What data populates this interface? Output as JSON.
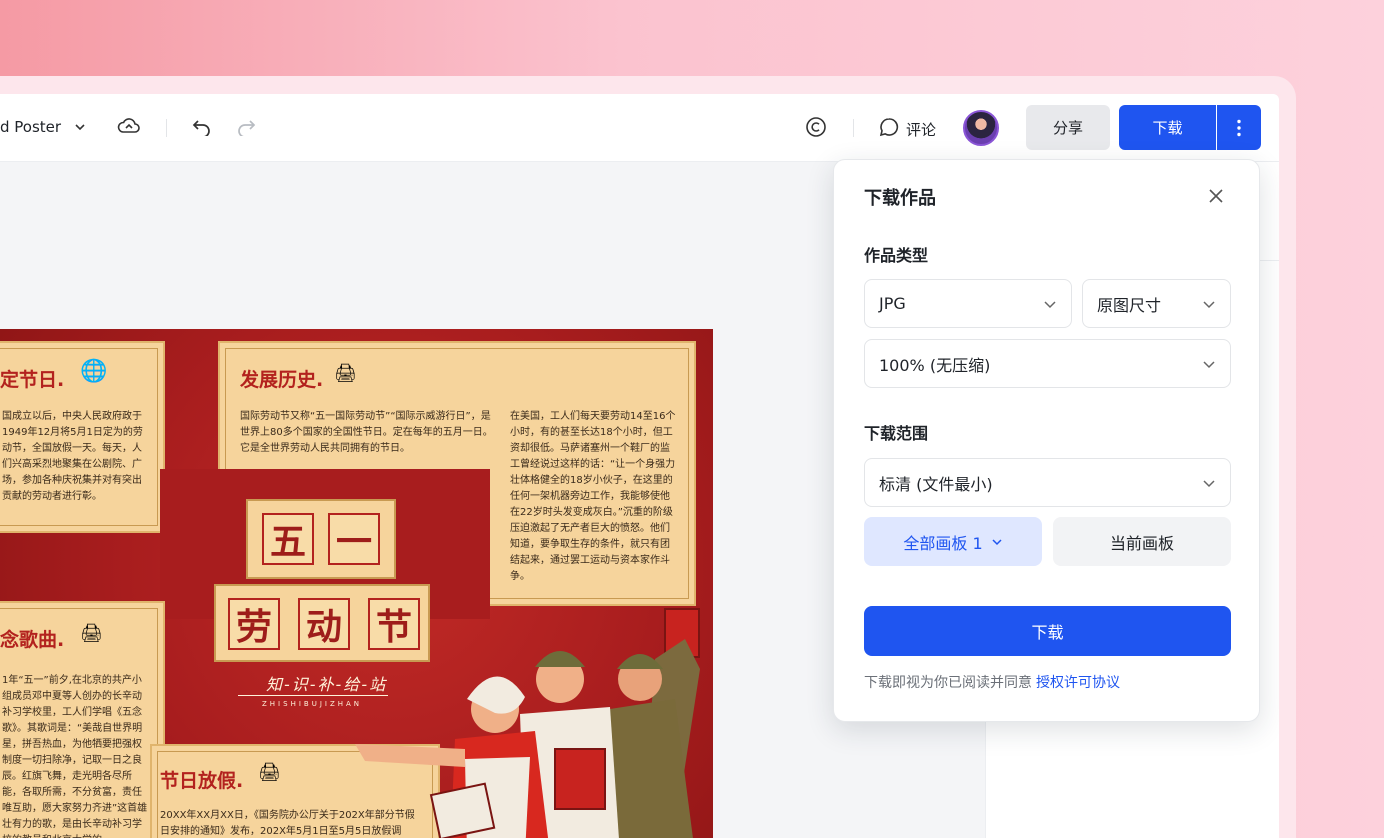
{
  "toolbar": {
    "doc_title": "d Poster",
    "comment_label": "评论",
    "share_label": "分享",
    "download_label": "下载"
  },
  "poster": {
    "card1": {
      "title": "定节日.",
      "text": "国成立以后，中央人民政府政于1949年12月将5月1日定为的劳动节，全国放假一天。每天，人们兴高采烈地聚集在公剧院、广场，参加各种庆祝集并对有突出贡献的劳动者进行彰。"
    },
    "card2": {
      "title": "发展历史.",
      "text_left": "国际劳动节又称“五一国际劳动节”“国际示威游行日”，是世界上80多个国家的全国性节日。定在每年的五月一日。它是全世界劳动人民共同拥有的节日。",
      "text_right": "在美国，工人们每天要劳动14至16个小时，有的甚至长达18个小时，但工资却很低。马萨诸塞州一个鞋厂的监工曾经说过这样的话：“让一个身强力壮体格健全的18岁小伙子，在这里的任何一架机器旁边工作，我能够使他在22岁时头发变成灰白。”沉重的阶级压迫激起了无产者巨大的愤怒。他们知道，要争取生存的条件，就只有团结起来，通过罢工运动与资本家作斗争。"
    },
    "card3": {
      "title": "念歌曲.",
      "text": "1年“五一”前夕,在北京的共产小组成员邓中夏等人创办的长辛动补习学校里，工人们学唱《五念歌》。其歌词是：“美哉自世界明星，拼吾热血，为他牺要把强权制度一切扫除净，记取一日之良辰。红旗飞舞，走光明各尽所能，各取所需，不分贫富，责任唯互助，愿大家努力齐进”这首雄壮有力的歌，是由长辛动补习学校的教员和北京大学的"
    },
    "card4": {
      "title": "节日放假.",
      "text": "20XX年XX月XX日，《国务院办公厅关于202X年部分节假日安排的通知》发布，202X年5月1日至5月5日放假调"
    },
    "big_title_1": [
      "五",
      "一"
    ],
    "big_title_2": [
      "劳",
      "动",
      "节"
    ],
    "subtitle": "知-识-补-给-站",
    "subtitle_en": "ZHISHIBUJIZHAN"
  },
  "download_panel": {
    "title": "下载作品",
    "type_label": "作品类型",
    "format_value": "JPG",
    "size_value": "原图尺寸",
    "quality_value": "100% (无压缩)",
    "range_label": "下载范围",
    "resolution_value": "标清 (文件最小)",
    "all_pages_label": "全部画板 1",
    "current_page_label": "当前画板",
    "download_button": "下载",
    "agree_text": "下载即视为你已阅读并同意",
    "agree_link": "授权许可协议"
  },
  "colors": {
    "accent": "#1f55f0",
    "poster_red": "#a81d1e",
    "poster_paper": "#f6d49c"
  }
}
